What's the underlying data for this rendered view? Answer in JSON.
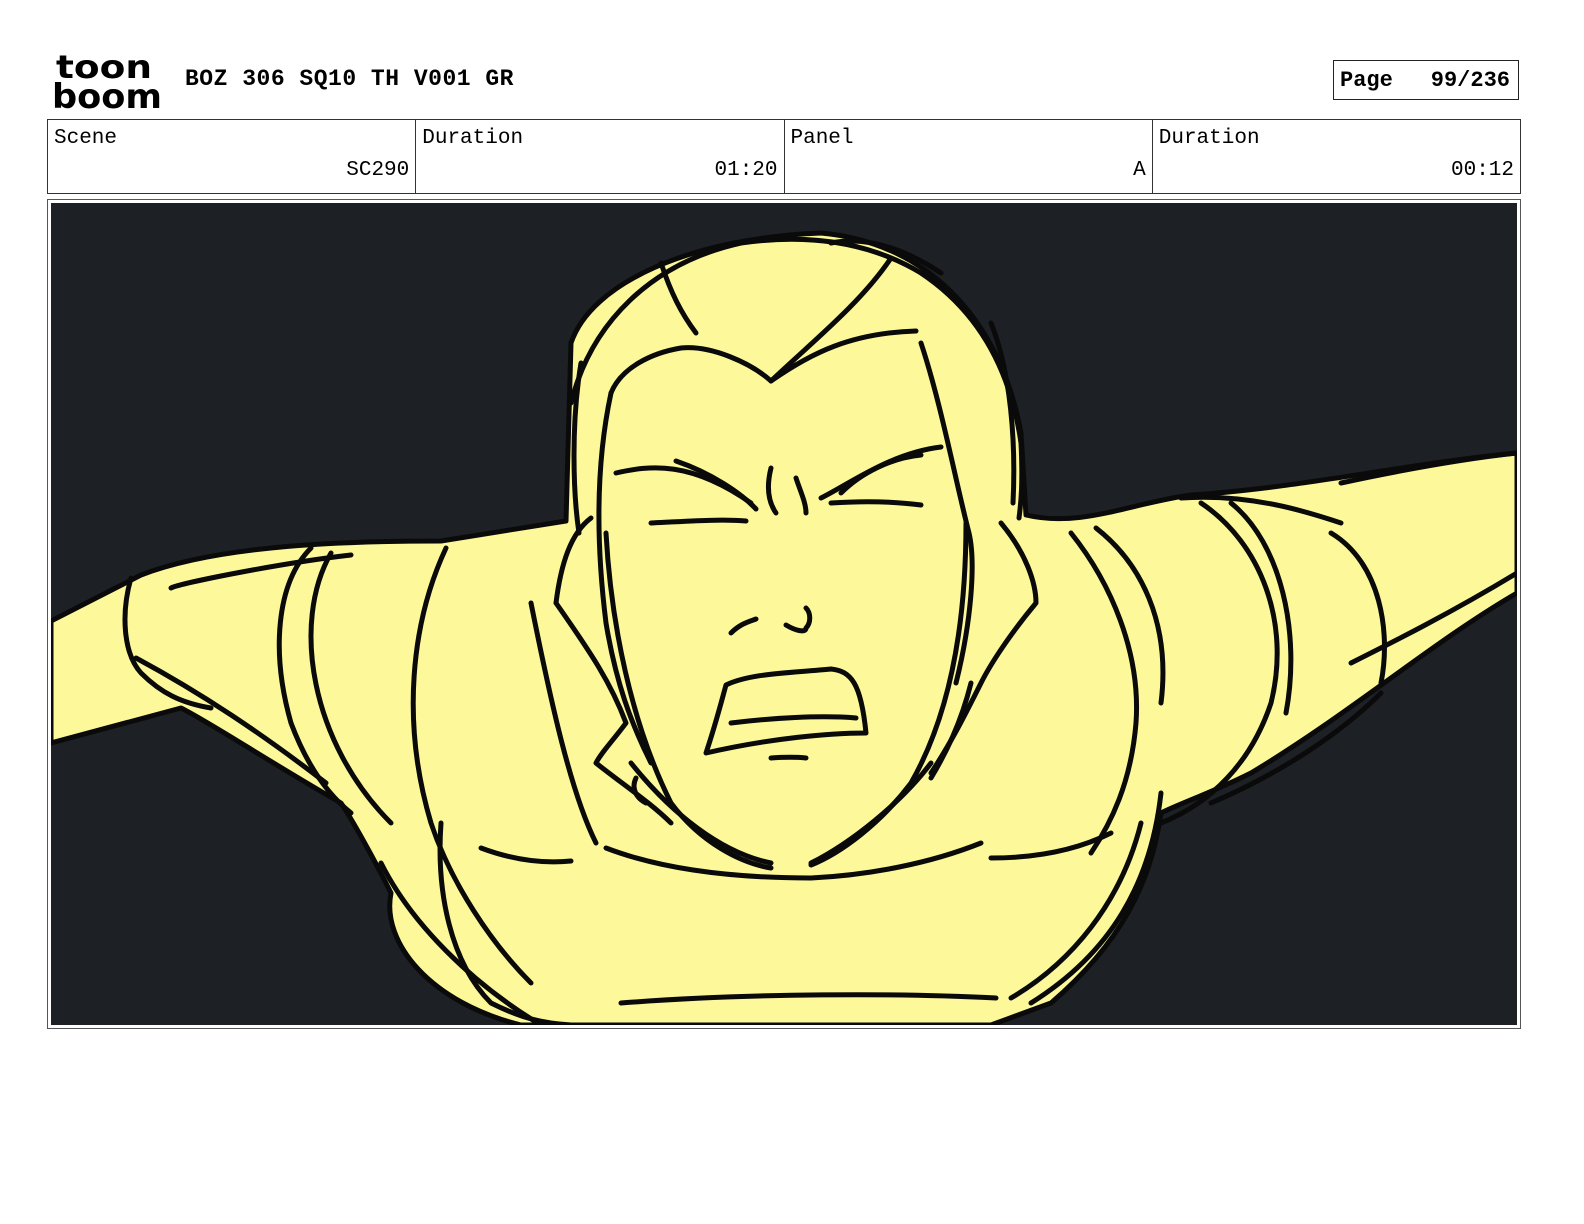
{
  "header": {
    "logo_top": "toon",
    "logo_bottom": "boom",
    "title": "BOZ 306 SQ10 TH V001 GR",
    "page_label": "Page",
    "page_number": "99/236"
  },
  "info": {
    "scene_label": "Scene",
    "scene_value": "SC290",
    "scene_duration_label": "Duration",
    "scene_duration_value": "01:20",
    "panel_label": "Panel",
    "panel_value": "A",
    "panel_duration_label": "Duration",
    "panel_duration_value": "00:12"
  },
  "colors": {
    "panel_background": "#1d2024",
    "figure_fill": "#fdf99a",
    "line": "#0a0a0a"
  }
}
